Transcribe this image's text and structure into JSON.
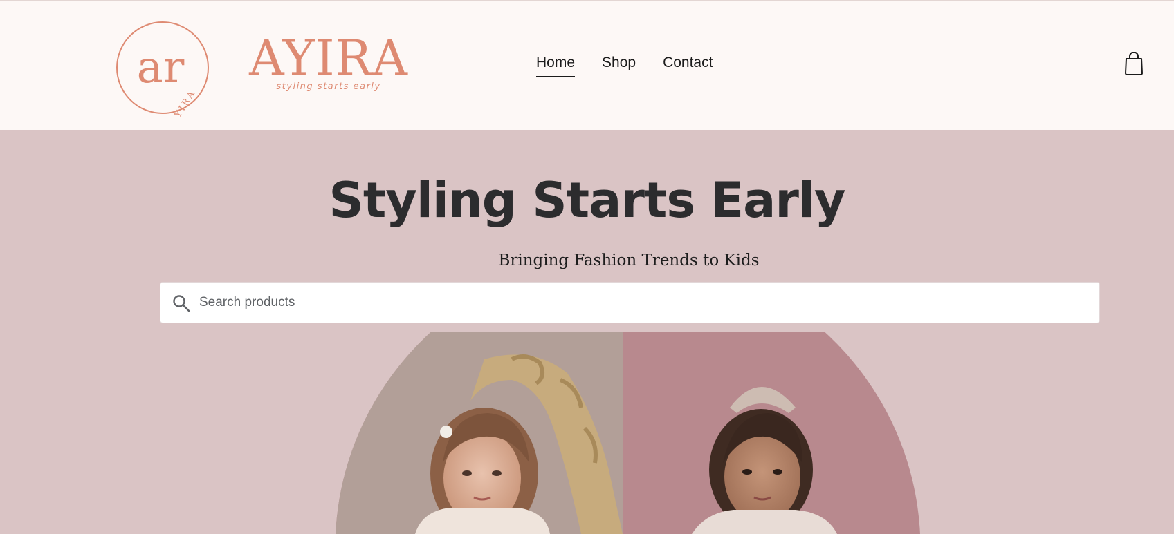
{
  "brand": {
    "name": "AYIRA",
    "tagline": "styling starts early",
    "monogram": "ar",
    "colors": {
      "accent": "#de8a72",
      "header_bg": "#fdf8f6",
      "hero_bg": "#dac4c5"
    }
  },
  "nav": {
    "items": [
      {
        "label": "Home",
        "active": true
      },
      {
        "label": "Shop",
        "active": false
      },
      {
        "label": "Contact",
        "active": false
      }
    ]
  },
  "cart": {
    "icon": "shopping-bag-icon"
  },
  "hero": {
    "title": "Styling Starts Early",
    "subtitle": "Bringing Fashion Trends to Kids"
  },
  "search": {
    "placeholder": "Search products",
    "value": "",
    "icon": "search-icon"
  }
}
